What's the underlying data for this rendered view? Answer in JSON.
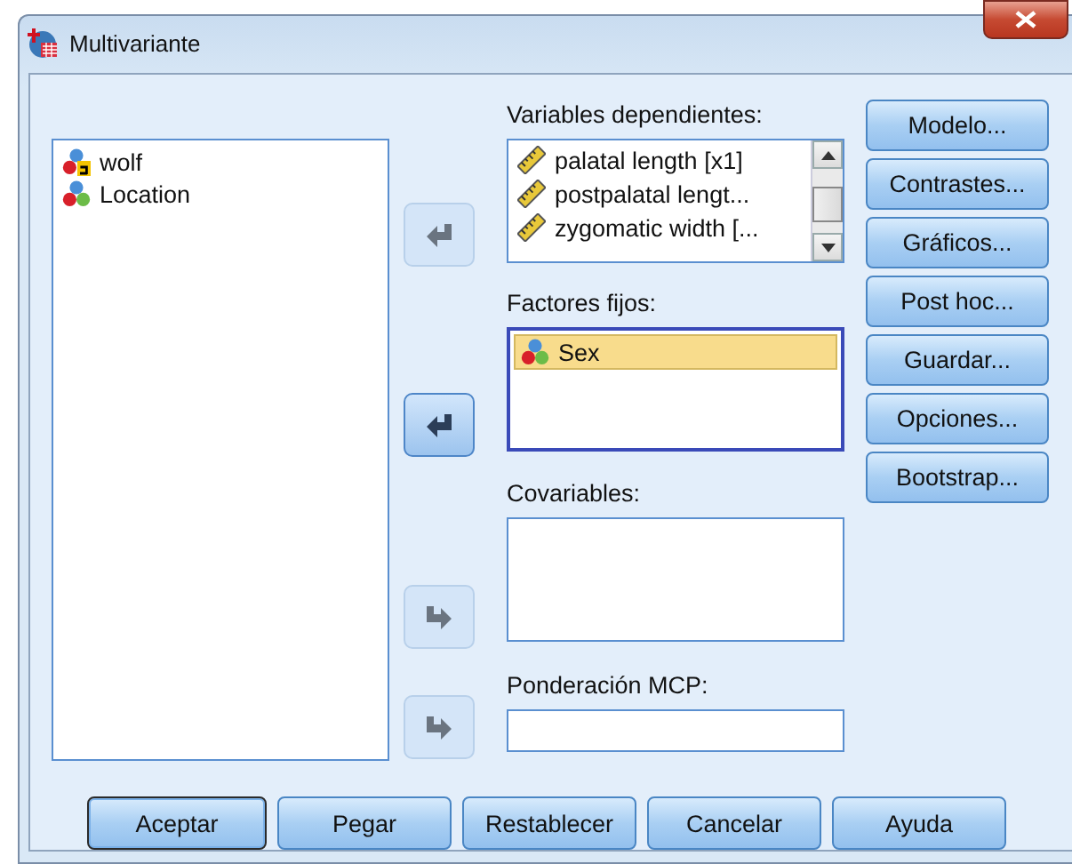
{
  "window": {
    "title": "Multivariante"
  },
  "source_list": {
    "items": [
      {
        "label": "wolf",
        "kind": "nominal-string"
      },
      {
        "label": "Location",
        "kind": "nominal"
      }
    ]
  },
  "transfer_buttons": [
    {
      "kind": "remove",
      "active": false
    },
    {
      "kind": "remove",
      "active": true
    },
    {
      "kind": "add",
      "active": false
    },
    {
      "kind": "add",
      "active": false
    }
  ],
  "dependent_variables": {
    "label": "Variables dependientes:",
    "items": [
      {
        "label": "palatal length [x1]",
        "kind": "scale"
      },
      {
        "label": "postpalatal lengt...",
        "kind": "scale"
      },
      {
        "label": "zygomatic width [...",
        "kind": "scale"
      }
    ]
  },
  "fixed_factors": {
    "label": "Factores fijos:",
    "items": [
      {
        "label": "Sex",
        "kind": "nominal",
        "selected": true
      }
    ]
  },
  "covariates": {
    "label": "Covariables:"
  },
  "wls_weight": {
    "label": "Ponderación MCP:"
  },
  "side_buttons": [
    {
      "label": "Modelo..."
    },
    {
      "label": "Contrastes..."
    },
    {
      "label": "Gráficos..."
    },
    {
      "label": "Post hoc..."
    },
    {
      "label": "Guardar..."
    },
    {
      "label": "Opciones..."
    },
    {
      "label": "Bootstrap..."
    }
  ],
  "bottom_buttons": [
    {
      "label": "Aceptar",
      "default": true
    },
    {
      "label": "Pegar",
      "default": false
    },
    {
      "label": "Restablecer",
      "default": false
    },
    {
      "label": "Cancelar",
      "default": false
    },
    {
      "label": "Ayuda",
      "default": false
    }
  ]
}
